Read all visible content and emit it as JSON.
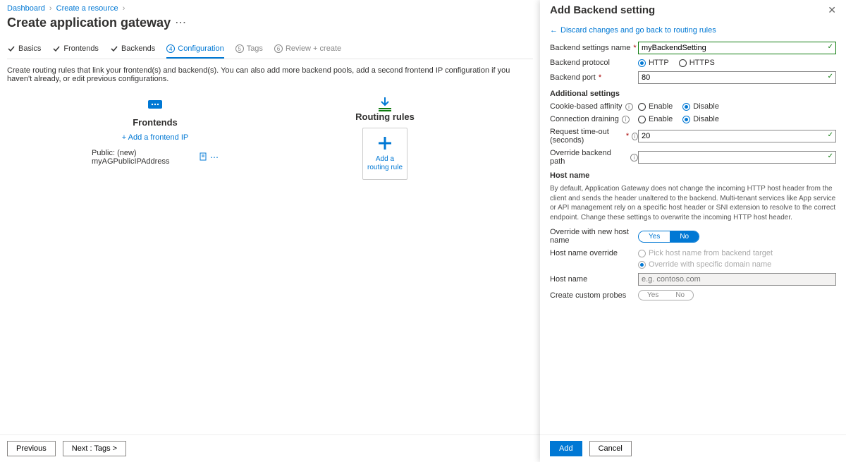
{
  "breadcrumb": {
    "items": [
      "Dashboard",
      "Create a resource"
    ]
  },
  "page_title": "Create application gateway",
  "tabs": [
    {
      "label": "Basics",
      "state": "done"
    },
    {
      "label": "Frontends",
      "state": "done"
    },
    {
      "label": "Backends",
      "state": "done"
    },
    {
      "label": "Configuration",
      "state": "active",
      "num": "4"
    },
    {
      "label": "Tags",
      "state": "pending",
      "num": "5"
    },
    {
      "label": "Review + create",
      "state": "pending",
      "num": "6"
    }
  ],
  "description": "Create routing rules that link your frontend(s) and backend(s). You can also add more backend pools, add a second frontend IP configuration if you haven't already, or edit previous configurations.",
  "frontends": {
    "title": "Frontends",
    "add_link": "+ Add a frontend IP",
    "item_label": "Public: (new) myAGPublicIPAddress"
  },
  "routing": {
    "title": "Routing rules",
    "tile_caption": "Add a routing rule"
  },
  "buttons": {
    "previous": "Previous",
    "next": "Next : Tags >"
  },
  "panel": {
    "title": "Add Backend setting",
    "discard_link": "Discard changes and go back to routing rules",
    "labels": {
      "name": "Backend settings name",
      "protocol": "Backend protocol",
      "port": "Backend port",
      "additional": "Additional settings",
      "affinity": "Cookie-based affinity",
      "draining": "Connection draining",
      "timeout": "Request time-out (seconds)",
      "override_path": "Override backend path",
      "hostname_section": "Host name",
      "hostname_desc": "By default, Application Gateway does not change the incoming HTTP host header from the client and sends the header unaltered to the backend. Multi-tenant services like App service or API management rely on a specific host header or SNI extension to resolve to the correct endpoint. Change these settings to overwrite the incoming HTTP host header.",
      "override_new_host": "Override with new host name",
      "hostname_override": "Host name override",
      "pick_from_backend": "Pick host name from backend target",
      "override_specific": "Override with specific domain name",
      "hostname": "Host name",
      "custom_probes": "Create custom probes"
    },
    "values": {
      "name": "myBackendSetting",
      "port": "80",
      "timeout": "20",
      "hostname_placeholder": "e.g. contoso.com",
      "http": "HTTP",
      "https": "HTTPS",
      "enable": "Enable",
      "disable": "Disable",
      "yes": "Yes",
      "no": "No"
    },
    "footer": {
      "add": "Add",
      "cancel": "Cancel"
    }
  }
}
